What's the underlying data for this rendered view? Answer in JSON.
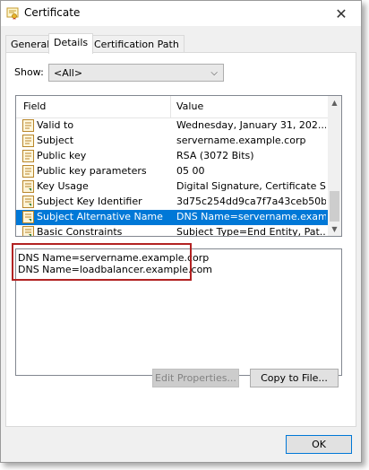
{
  "window": {
    "title": "Certificate",
    "close_glyph": "✕"
  },
  "tabs": [
    {
      "label": "General"
    },
    {
      "label": "Details"
    },
    {
      "label": "Certification Path"
    }
  ],
  "show": {
    "label": "Show:",
    "value": "<All>",
    "chevron": "⌵"
  },
  "list": {
    "header": {
      "field": "Field",
      "value": "Value"
    },
    "rows": [
      {
        "field": "Valid to",
        "value": "Wednesday, January 31, 202...",
        "icon": "certificate-field-icon"
      },
      {
        "field": "Subject",
        "value": "servername.example.corp",
        "icon": "certificate-field-icon"
      },
      {
        "field": "Public key",
        "value": "RSA (3072 Bits)",
        "icon": "certificate-field-icon"
      },
      {
        "field": "Public key parameters",
        "value": "05 00",
        "icon": "certificate-field-icon"
      },
      {
        "field": "Key Usage",
        "value": "Digital Signature, Certificate Si...",
        "icon": "extension-field-icon"
      },
      {
        "field": "Subject Key Identifier",
        "value": "3d75c254dd9ca7f7a43ceb50b...",
        "icon": "extension-field-icon"
      },
      {
        "field": "Subject Alternative Name",
        "value": "DNS Name=servername.exam...",
        "icon": "extension-field-icon",
        "selected": true
      },
      {
        "field": "Basic Constraints",
        "value": "Subject Type=End Entity, Pat...",
        "icon": "extension-field-icon"
      }
    ],
    "scroll_up": "▲",
    "scroll_down": "▼"
  },
  "details": {
    "lines": [
      "DNS Name=servername.example.corp",
      "DNS Name=loadbalancer.example.com"
    ]
  },
  "buttons": {
    "edit_properties": "Edit Properties...",
    "copy_to_file": "Copy to File...",
    "ok": "OK"
  },
  "colors": {
    "selection": "#0078d7",
    "highlight_box": "#b22222"
  }
}
